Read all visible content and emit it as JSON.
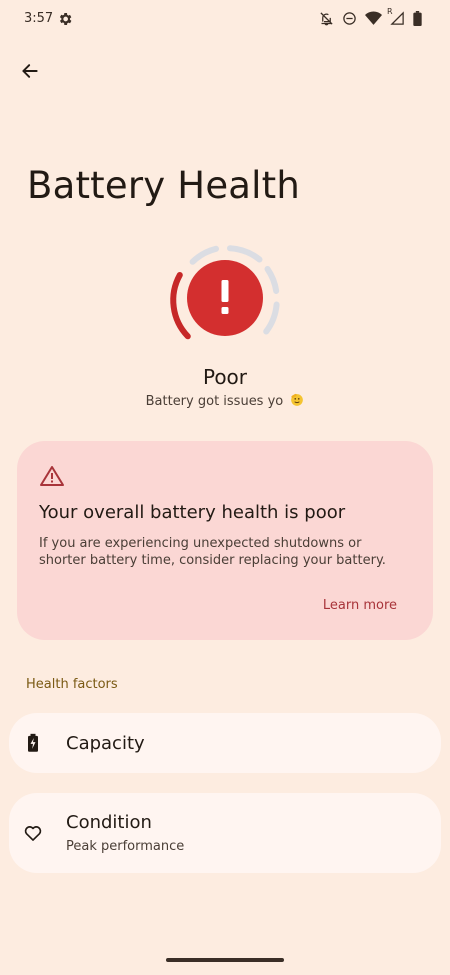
{
  "status_bar": {
    "time": "3:57",
    "icons": [
      "settings-icon",
      "notifications-off-icon",
      "do-not-disturb-icon",
      "wifi-icon",
      "cell-signal-icon",
      "battery-icon"
    ],
    "signal_label": "R"
  },
  "header": {
    "back_icon": "back-arrow-icon",
    "title": "Battery Health"
  },
  "health_status": {
    "icon": "alert-icon",
    "label": "Poor",
    "subtitle": "Battery got issues yo",
    "colors": {
      "alert": "#d32f2f",
      "ring": "#c62828",
      "ring_track": "#dbdde3"
    }
  },
  "warning_card": {
    "icon": "warning-triangle-icon",
    "title": "Your overall battery health is poor",
    "text": "If you are experiencing unexpected shutdowns or shorter battery time, consider replacing your battery.",
    "action": "Learn more",
    "colors": {
      "background": "#fbd7d4",
      "accent": "#a8343a"
    }
  },
  "health_factors": {
    "header": "Health factors",
    "items": [
      {
        "icon": "battery-charging-icon",
        "title": "Capacity"
      },
      {
        "icon": "heart-icon",
        "title": "Condition",
        "subtitle": "Peak performance"
      }
    ]
  }
}
